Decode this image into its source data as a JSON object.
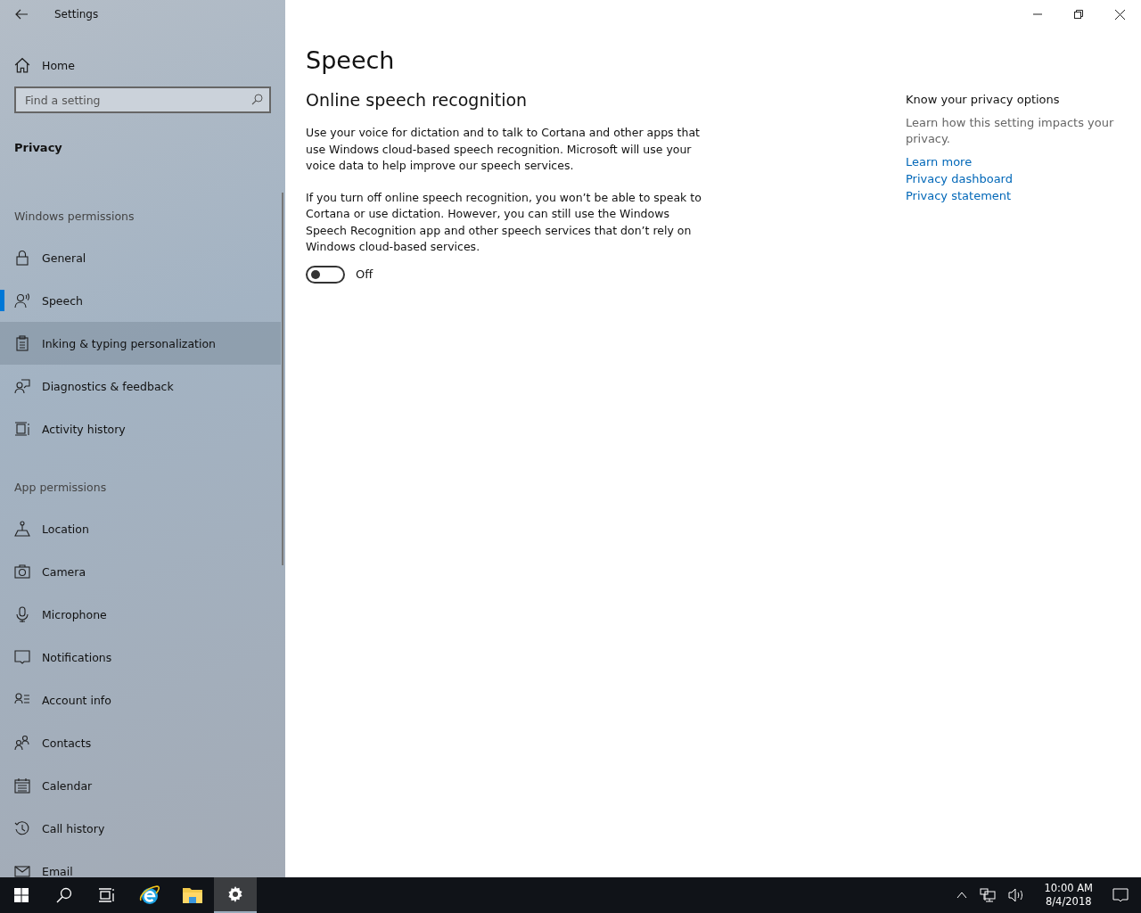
{
  "window": {
    "title": "Settings"
  },
  "sidebar": {
    "home": "Home",
    "search": {
      "placeholder": "Find a setting"
    },
    "section": "Privacy",
    "groups": [
      {
        "heading": "Windows permissions",
        "items": [
          {
            "label": "General",
            "selected": false,
            "highlighted": false
          },
          {
            "label": "Speech",
            "selected": true,
            "highlighted": false
          },
          {
            "label": "Inking & typing personalization",
            "selected": false,
            "highlighted": true
          },
          {
            "label": "Diagnostics & feedback",
            "selected": false,
            "highlighted": false
          },
          {
            "label": "Activity history",
            "selected": false,
            "highlighted": false
          }
        ]
      },
      {
        "heading": "App permissions",
        "items": [
          {
            "label": "Location",
            "selected": false,
            "highlighted": false
          },
          {
            "label": "Camera",
            "selected": false,
            "highlighted": false
          },
          {
            "label": "Microphone",
            "selected": false,
            "highlighted": false
          },
          {
            "label": "Notifications",
            "selected": false,
            "highlighted": false
          },
          {
            "label": "Account info",
            "selected": false,
            "highlighted": false
          },
          {
            "label": "Contacts",
            "selected": false,
            "highlighted": false
          },
          {
            "label": "Calendar",
            "selected": false,
            "highlighted": false
          },
          {
            "label": "Call history",
            "selected": false,
            "highlighted": false
          },
          {
            "label": "Email",
            "selected": false,
            "highlighted": false
          }
        ]
      }
    ]
  },
  "main": {
    "title": "Speech",
    "subtitle": "Online speech recognition",
    "paragraphs": [
      "Use your voice for dictation and to talk to Cortana and other apps that use Windows cloud-based speech recognition. Microsoft will use your voice data to help improve our speech services.",
      "If you turn off online speech recognition, you won’t be able to speak to Cortana or use dictation. However, you can still use the Windows Speech Recognition app and other speech services that don’t rely on Windows cloud-based services."
    ],
    "toggle": {
      "on": false,
      "label": "Off"
    }
  },
  "aside": {
    "heading": "Know your privacy options",
    "text": "Learn how this setting impacts your privacy.",
    "links": [
      "Learn more",
      "Privacy dashboard",
      "Privacy statement"
    ]
  },
  "taskbar": {
    "apps": [
      {
        "kind": "search",
        "selected": false
      },
      {
        "kind": "taskview",
        "selected": false
      },
      {
        "kind": "browser",
        "selected": false
      },
      {
        "kind": "folder",
        "selected": false
      },
      {
        "kind": "settings",
        "selected": true
      }
    ],
    "time": "10:00 AM",
    "date": "8/4/2018"
  }
}
